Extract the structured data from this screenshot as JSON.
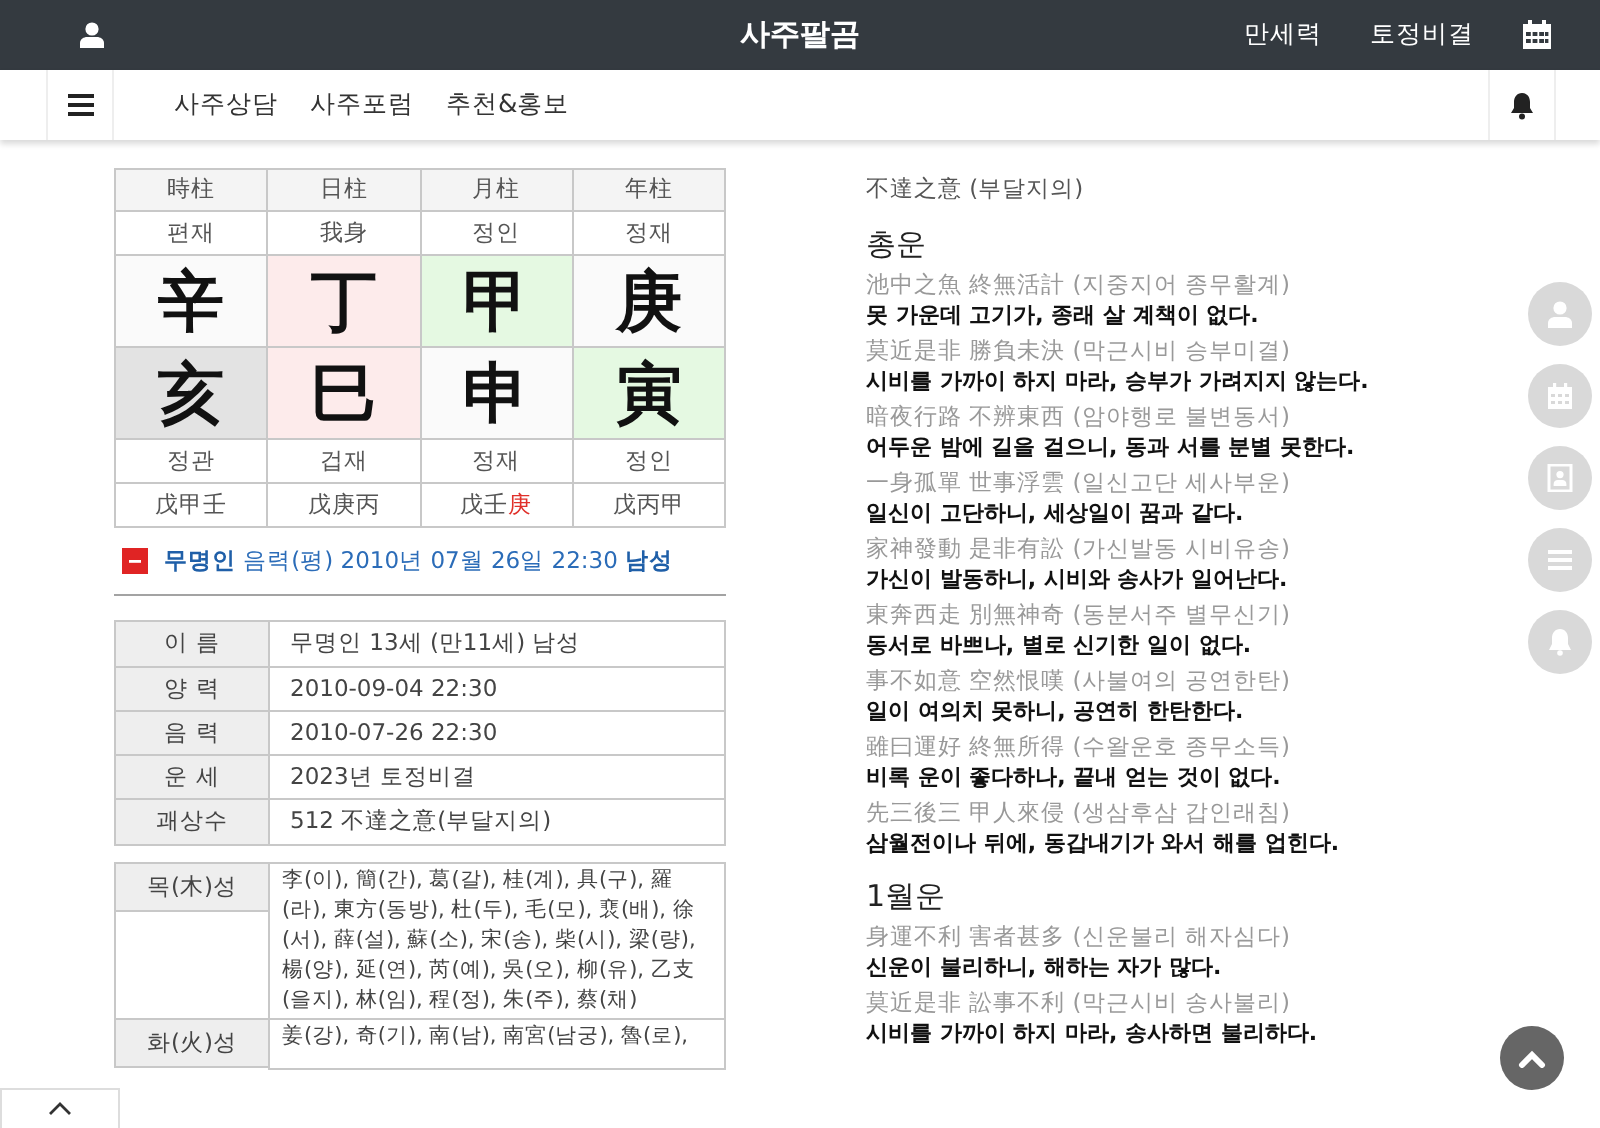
{
  "top_bar": {
    "title": "사주팔곰",
    "links": [
      "만세력",
      "토정비결"
    ]
  },
  "menu_bar": {
    "links": [
      "사주상담",
      "사주포럼",
      "추천&홍보"
    ]
  },
  "pillars": {
    "headers": [
      "時柱",
      "日柱",
      "月柱",
      "年柱"
    ],
    "stem_gods": [
      "편재",
      "我身",
      "정인",
      "정재"
    ],
    "stems": [
      {
        "char": "辛",
        "color": "#fafafa"
      },
      {
        "char": "丁",
        "color": "#fdebeb"
      },
      {
        "char": "甲",
        "color": "#e5f9e2"
      },
      {
        "char": "庚",
        "color": "#fafafa"
      }
    ],
    "branches": [
      {
        "char": "亥",
        "color": "#e3e3e3"
      },
      {
        "char": "巳",
        "color": "#fdebeb"
      },
      {
        "char": "申",
        "color": "#fafafa"
      },
      {
        "char": "寅",
        "color": "#e5f9e2"
      }
    ],
    "branch_gods": [
      "정관",
      "겁재",
      "정재",
      "정인"
    ],
    "hidden_stems": [
      [
        {
          "text": "戊甲壬",
          "highlight": false
        }
      ],
      [
        {
          "text": "戊庚丙",
          "highlight": false
        }
      ],
      [
        {
          "text": "戊壬",
          "highlight": false
        },
        {
          "text": "庚",
          "highlight": true
        }
      ],
      [
        {
          "text": "戊丙甲",
          "highlight": false
        }
      ]
    ]
  },
  "summary": {
    "text": "**무명인** 음력(평) 2010년 07월 26일 22:30 **남성**"
  },
  "info_rows": [
    {
      "label": "이 름",
      "value": "무명인 13세 (만11세) 남성"
    },
    {
      "label": "양 력",
      "value": "2010-09-04 22:30"
    },
    {
      "label": "음 력",
      "value": "2010-07-26 22:30"
    },
    {
      "label": "운 세",
      "value": "2023년 토정비결"
    },
    {
      "label": "괘상수",
      "value": "512 不達之意(부달지의)"
    }
  ],
  "surnames": [
    {
      "label": "목(木)성",
      "names": "李(이), 簡(간), 葛(갈), 桂(계), 具(구), 羅(라), 東方(동방), 杜(두), 毛(모), 裵(배), 徐(서), 薛(설), 蘇(소), 宋(송), 柴(시), 梁(량), 楊(양), 延(연), 芮(예), 吳(오), 柳(유), 乙支(을지), 林(임), 程(정), 朱(주), 蔡(채)"
    },
    {
      "label": "화(火)성",
      "names": "姜(강), 奇(기), 南(남), 南宮(남궁), 魯(로),"
    }
  ],
  "fortune": {
    "title": "不達之意 (부달지의)",
    "sections": [
      {
        "heading": "총운",
        "items": [
          {
            "hanja": "池中之魚 終無活計 (지중지어 종무활계)",
            "meaning": "못 가운데 고기가, 종래 살 계책이 없다."
          },
          {
            "hanja": "莫近是非 勝負未決 (막근시비 승부미결)",
            "meaning": "시비를 가까이 하지 마라, 승부가 가려지지 않는다."
          },
          {
            "hanja": "暗夜行路 不辨東西 (암야행로 불변동서)",
            "meaning": "어두운 밤에 길을 걸으니, 동과 서를 분별 못한다."
          },
          {
            "hanja": "一身孤單 世事浮雲 (일신고단 세사부운)",
            "meaning": "일신이 고단하니, 세상일이 꿈과 같다."
          },
          {
            "hanja": "家神發動 是非有訟 (가신발동 시비유송)",
            "meaning": "가신이 발동하니, 시비와 송사가 일어난다."
          },
          {
            "hanja": "東奔西走 別無神奇 (동분서주 별무신기)",
            "meaning": "동서로 바쁘나, 별로 신기한 일이 없다."
          },
          {
            "hanja": "事不如意 空然恨嘆 (사불여의 공연한탄)",
            "meaning": "일이 여의치 못하니, 공연히 한탄한다."
          },
          {
            "hanja": "雖曰運好 終無所得 (수왈운호 종무소득)",
            "meaning": "비록 운이 좋다하나, 끝내 얻는 것이 없다."
          },
          {
            "hanja": "先三後三 甲人來侵 (생삼후삼 갑인래침)",
            "meaning": "삼월전이나 뒤에, 동갑내기가 와서 해를 업힌다."
          }
        ]
      },
      {
        "heading": "1월운",
        "items": [
          {
            "hanja": "身運不利 害者甚多 (신운불리 해자심다)",
            "meaning": "신운이 불리하니, 해하는 자가 많다."
          },
          {
            "hanja": "莫近是非 訟事不利 (막근시비 송사불리)",
            "meaning": "시비를 가까이 하지 마라, 송사하면 불리하다."
          }
        ]
      }
    ]
  }
}
